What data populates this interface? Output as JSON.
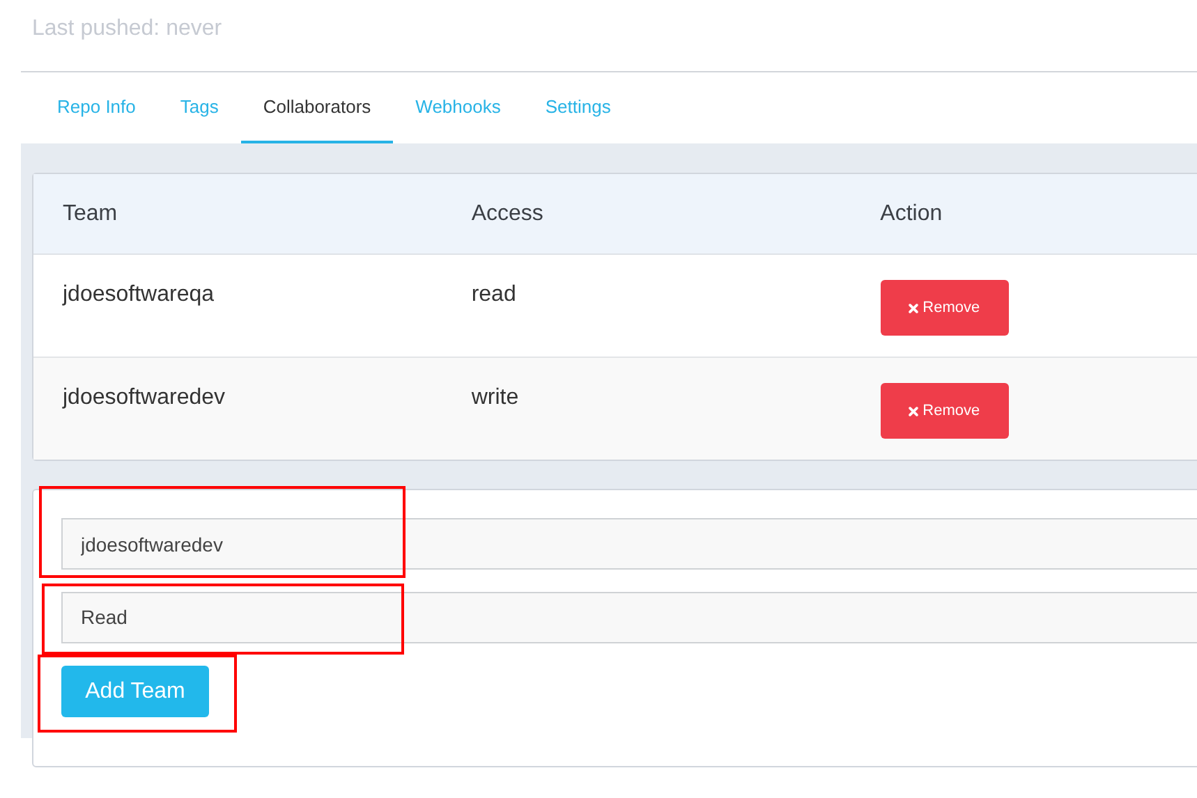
{
  "repo": {
    "last_pushed": "Last pushed: never"
  },
  "tabs": [
    {
      "label": "Repo Info",
      "selected": false
    },
    {
      "label": "Tags",
      "selected": false
    },
    {
      "label": "Collaborators",
      "selected": true
    },
    {
      "label": "Webhooks",
      "selected": false
    },
    {
      "label": "Settings",
      "selected": false
    }
  ],
  "table": {
    "columns": [
      "Team",
      "Access",
      "Action"
    ],
    "rows": [
      {
        "team": "jdoesoftwareqa",
        "access": "read",
        "action": "Remove"
      },
      {
        "team": "jdoesoftwaredev",
        "access": "write",
        "action": "Remove"
      }
    ]
  },
  "form": {
    "team_field": {
      "value": "jdoesoftwaredev",
      "highlighted": true
    },
    "access_select": {
      "value": "Read",
      "highlighted": true
    },
    "add_button": {
      "label": "Add Team",
      "highlighted": true
    }
  }
}
